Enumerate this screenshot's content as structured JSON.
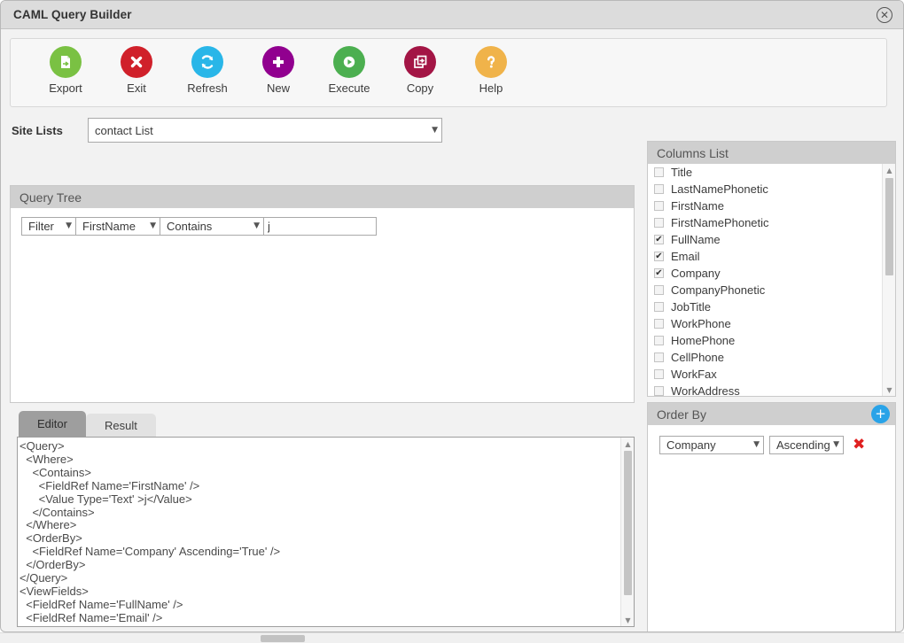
{
  "window": {
    "title": "CAML Query Builder",
    "close_icon": "close-circle-icon"
  },
  "toolbar": {
    "buttons": [
      {
        "label": "Export",
        "icon": "export-document-icon",
        "color": "#7ac143",
        "glyph": "→"
      },
      {
        "label": "Exit",
        "icon": "exit-cross-icon",
        "color": "#d0202a",
        "glyph": "✖"
      },
      {
        "label": "Refresh",
        "icon": "refresh-icon",
        "color": "#29b6e8",
        "glyph": "↻"
      },
      {
        "label": "New",
        "icon": "new-plus-icon",
        "color": "#91008f",
        "glyph": "✚"
      },
      {
        "label": "Execute",
        "icon": "execute-play-icon",
        "color": "#4caf50",
        "glyph": "▶"
      },
      {
        "label": "Copy",
        "icon": "copy-icon",
        "color": "#a31545",
        "glyph": "❐"
      },
      {
        "label": "Help",
        "icon": "help-question-icon",
        "color": "#f0b34a",
        "glyph": "?"
      }
    ]
  },
  "site_lists": {
    "label": "Site Lists",
    "selected": "contact List",
    "caret": "▼"
  },
  "query_tree": {
    "header": "Query Tree",
    "filter_row": {
      "type": "Filter",
      "field": "FirstName",
      "operator": "Contains",
      "value": "j",
      "value_placeholder": ""
    }
  },
  "editor": {
    "tabs": [
      {
        "label": "Editor",
        "active": true
      },
      {
        "label": "Result",
        "active": false
      }
    ],
    "xml": "<Query>\n  <Where>\n    <Contains>\n      <FieldRef Name='FirstName' />\n      <Value Type='Text' >j</Value>\n    </Contains>\n  </Where>\n  <OrderBy>\n    <FieldRef Name='Company' Ascending='True' />\n  </OrderBy>\n</Query>\n<ViewFields>\n  <FieldRef Name='FullName' />\n  <FieldRef Name='Email' />"
  },
  "columns_list": {
    "header": "Columns List",
    "items": [
      {
        "label": "Title",
        "checked": false
      },
      {
        "label": "LastNamePhonetic",
        "checked": false
      },
      {
        "label": "FirstName",
        "checked": false
      },
      {
        "label": "FirstNamePhonetic",
        "checked": false
      },
      {
        "label": "FullName",
        "checked": true
      },
      {
        "label": "Email",
        "checked": true
      },
      {
        "label": "Company",
        "checked": true
      },
      {
        "label": "CompanyPhonetic",
        "checked": false
      },
      {
        "label": "JobTitle",
        "checked": false
      },
      {
        "label": "WorkPhone",
        "checked": false
      },
      {
        "label": "HomePhone",
        "checked": false
      },
      {
        "label": "CellPhone",
        "checked": false
      },
      {
        "label": "WorkFax",
        "checked": false
      },
      {
        "label": "WorkAddress",
        "checked": false
      }
    ],
    "check_glyph": "✔"
  },
  "order_by": {
    "header": "Order By",
    "add_label": "+",
    "add_icon": "add-circle-icon",
    "rows": [
      {
        "field": "Company",
        "direction": "Ascending",
        "delete_icon": "delete-x-icon",
        "delete_glyph": "✖"
      }
    ]
  }
}
